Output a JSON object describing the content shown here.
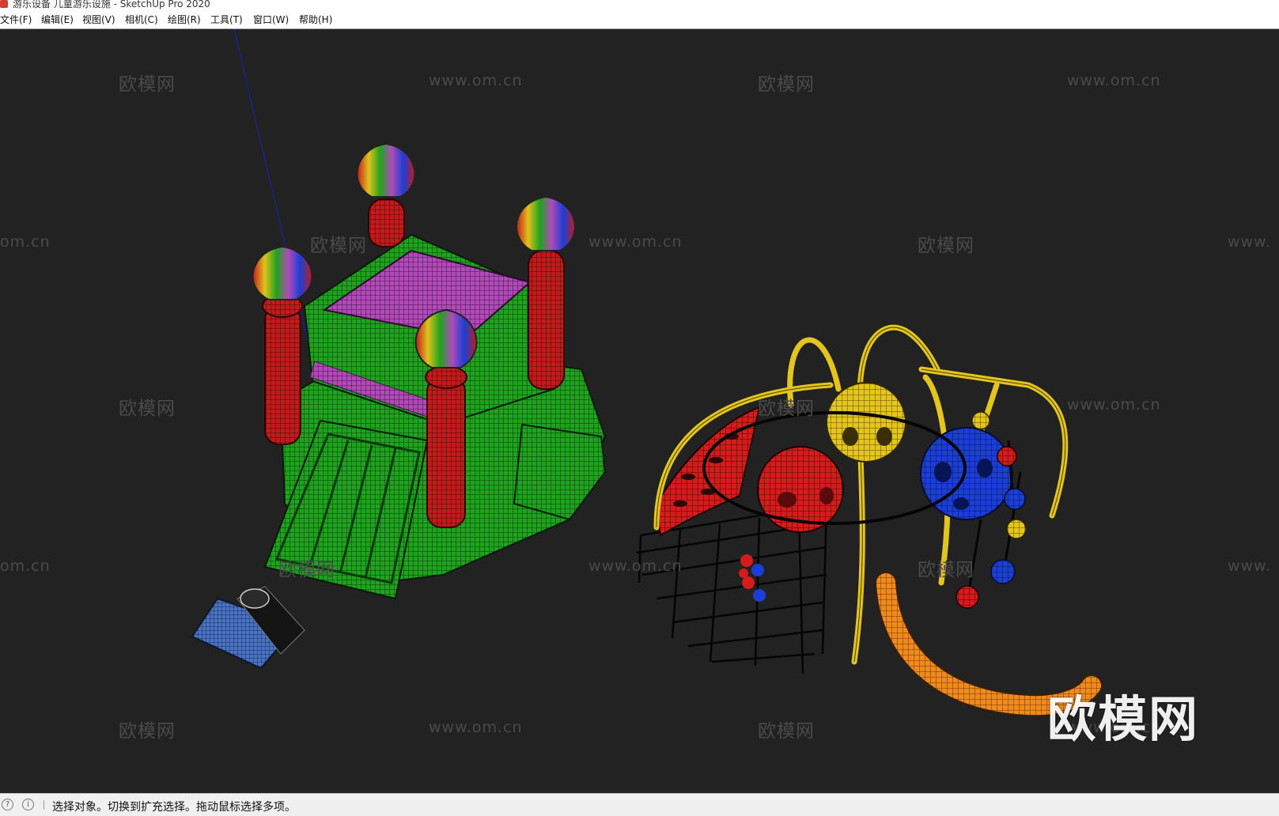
{
  "window": {
    "title": "游乐设备 儿童游乐设施 - SketchUp Pro 2020"
  },
  "menu": {
    "items": [
      "文件(F)",
      "编辑(E)",
      "视图(V)",
      "相机(C)",
      "绘图(R)",
      "工具(T)",
      "窗口(W)",
      "帮助(H)"
    ]
  },
  "watermark": {
    "logo_text": "欧模网",
    "url_text": "www.om.cn",
    "partial_url_left": "om.cn",
    "partial_url_right": "www."
  },
  "status": {
    "message": "选择对象。切换到扩充选择。拖动鼠标选择多项。",
    "icons": [
      "help-icon",
      "info-icon"
    ]
  },
  "colors": {
    "viewport_bg": "#222222",
    "castle_green": "#1fa31f",
    "castle_red": "#c21b1b",
    "castle_purple": "#b14ab8",
    "playground_yellow": "#e0c21c",
    "playground_red": "#d51c1c",
    "playground_blue": "#1b3fd6",
    "slide_orange": "#f08a1c"
  }
}
